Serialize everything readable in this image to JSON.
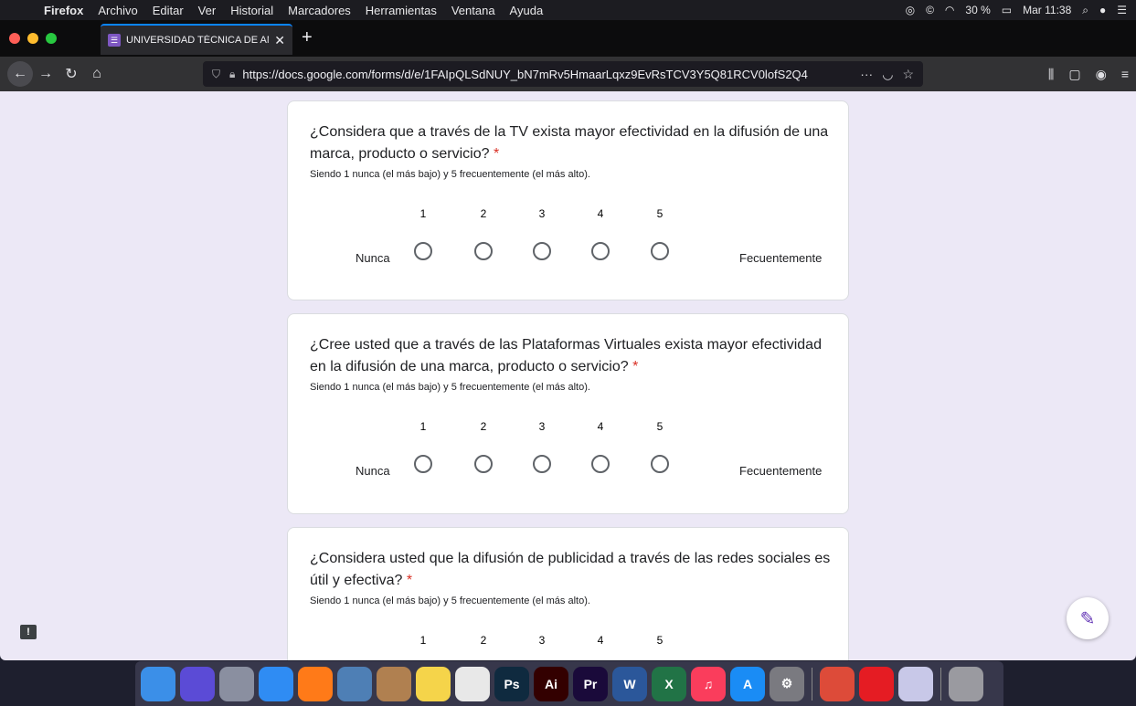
{
  "menubar": {
    "apple": "",
    "items": [
      "Firefox",
      "Archivo",
      "Editar",
      "Ver",
      "Historial",
      "Marcadores",
      "Herramientas",
      "Ventana",
      "Ayuda"
    ],
    "battery": "30 %",
    "clock": "Mar 11:38"
  },
  "tab": {
    "title": "UNIVERSIDAD TÉCNICA DE AM",
    "close": "✕"
  },
  "navbar": {
    "url": "https://docs.google.com/forms/d/e/1FAIpQLSdNUY_bN7mRv5HmaarLqxz9EvRsTCV3Y5Q81RCV0lofS2Q4",
    "more": "···"
  },
  "form": {
    "questions": [
      {
        "text": "¿Considera que a través de la TV exista mayor efectividad en la difusión de una marca, producto o servicio?",
        "required": " *",
        "description": "Siendo 1 nunca (el más bajo) y 5 frecuentemente (el más alto).",
        "scale": [
          "1",
          "2",
          "3",
          "4",
          "5"
        ],
        "low_label": "Nunca",
        "high_label": "Fecuentemente"
      },
      {
        "text": "¿Cree usted que a través de las Plataformas Virtuales exista mayor efectividad en la difusión de una marca, producto o servicio?",
        "required": " *",
        "description": "Siendo 1 nunca (el más bajo) y 5 frecuentemente (el más alto).",
        "scale": [
          "1",
          "2",
          "3",
          "4",
          "5"
        ],
        "low_label": "Nunca",
        "high_label": "Fecuentemente"
      },
      {
        "text": "¿Considera usted que la difusión de publicidad a través de las redes sociales es útil y efectiva?",
        "required": " *",
        "description": "Siendo 1 nunca (el más bajo) y 5 frecuentemente (el más alto).",
        "scale": [
          "1",
          "2",
          "3",
          "4",
          "5"
        ]
      }
    ]
  },
  "feedback": "!",
  "dock": {
    "apps": [
      {
        "name": "finder-icon",
        "label": "",
        "color": "#3b8fe8"
      },
      {
        "name": "siri-icon",
        "label": "",
        "color": "#5b4bd6"
      },
      {
        "name": "launchpad-icon",
        "label": "",
        "color": "#8a8fa0"
      },
      {
        "name": "safari-icon",
        "label": "",
        "color": "#2f8cf3"
      },
      {
        "name": "firefox-icon",
        "label": "",
        "color": "#ff7a18"
      },
      {
        "name": "preview-icon",
        "label": "",
        "color": "#4e7fb5"
      },
      {
        "name": "contacts-icon",
        "label": "",
        "color": "#b08050"
      },
      {
        "name": "notes-icon",
        "label": "",
        "color": "#f5d44a"
      },
      {
        "name": "photos-icon",
        "label": "",
        "color": "#e8e8e8"
      },
      {
        "name": "photoshop-icon",
        "label": "Ps",
        "color": "#0f2a3f"
      },
      {
        "name": "illustrator-icon",
        "label": "Ai",
        "color": "#330000"
      },
      {
        "name": "premiere-icon",
        "label": "Pr",
        "color": "#1a0a3a"
      },
      {
        "name": "word-icon",
        "label": "W",
        "color": "#2b579a"
      },
      {
        "name": "excel-icon",
        "label": "X",
        "color": "#217346"
      },
      {
        "name": "music-icon",
        "label": "♫",
        "color": "#fa3d5c"
      },
      {
        "name": "app-store-icon",
        "label": "A",
        "color": "#1a8cf5"
      },
      {
        "name": "system-preferences-icon",
        "label": "⚙",
        "color": "#7a7a80"
      },
      {
        "name": "chrome-icon",
        "label": "",
        "color": "#dd4b39"
      },
      {
        "name": "acrobat-icon",
        "label": "",
        "color": "#e51c23"
      },
      {
        "name": "torrent-icon",
        "label": "",
        "color": "#c8c8e8"
      },
      {
        "name": "trash-icon",
        "label": "",
        "color": "#9a9aa0"
      }
    ]
  }
}
